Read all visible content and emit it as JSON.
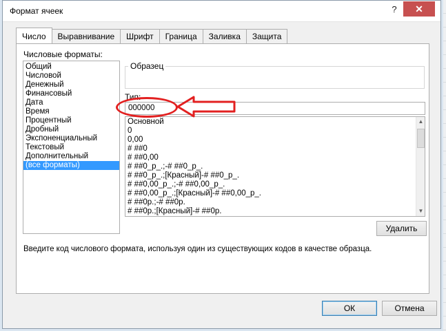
{
  "window": {
    "title": "Формат ячеек",
    "help": "?",
    "close": "✕"
  },
  "tabs": [
    "Число",
    "Выравнивание",
    "Шрифт",
    "Граница",
    "Заливка",
    "Защита"
  ],
  "categories": {
    "label": "Числовые форматы:",
    "items": [
      "Общий",
      "Числовой",
      "Денежный",
      "Финансовый",
      "Дата",
      "Время",
      "Процентный",
      "Дробный",
      "Экспоненциальный",
      "Текстовый",
      "Дополнительный",
      "(все форматы)"
    ],
    "selected": "(все форматы)"
  },
  "sample": {
    "label": "Образец",
    "value": ""
  },
  "type": {
    "label": "Тип:",
    "value": "000000",
    "formats": [
      "Основной",
      "0",
      "0,00",
      "# ##0",
      "# ##0,00",
      "# ##0_р_.;-# ##0_р_.",
      "# ##0_р_.;[Красный]-# ##0_р_.",
      "# ##0,00_р_.;-# ##0,00_р_.",
      "# ##0,00_р_.;[Красный]-# ##0,00_р_.",
      "# ##0р.;-# ##0р.",
      "# ##0р.;[Красный]-# ##0р."
    ]
  },
  "buttons": {
    "delete": "Удалить",
    "ok": "ОК",
    "cancel": "Отмена"
  },
  "hint": "Введите код числового формата, используя один из существующих кодов в качестве образца.",
  "annotation": {
    "color": "#e22020"
  }
}
